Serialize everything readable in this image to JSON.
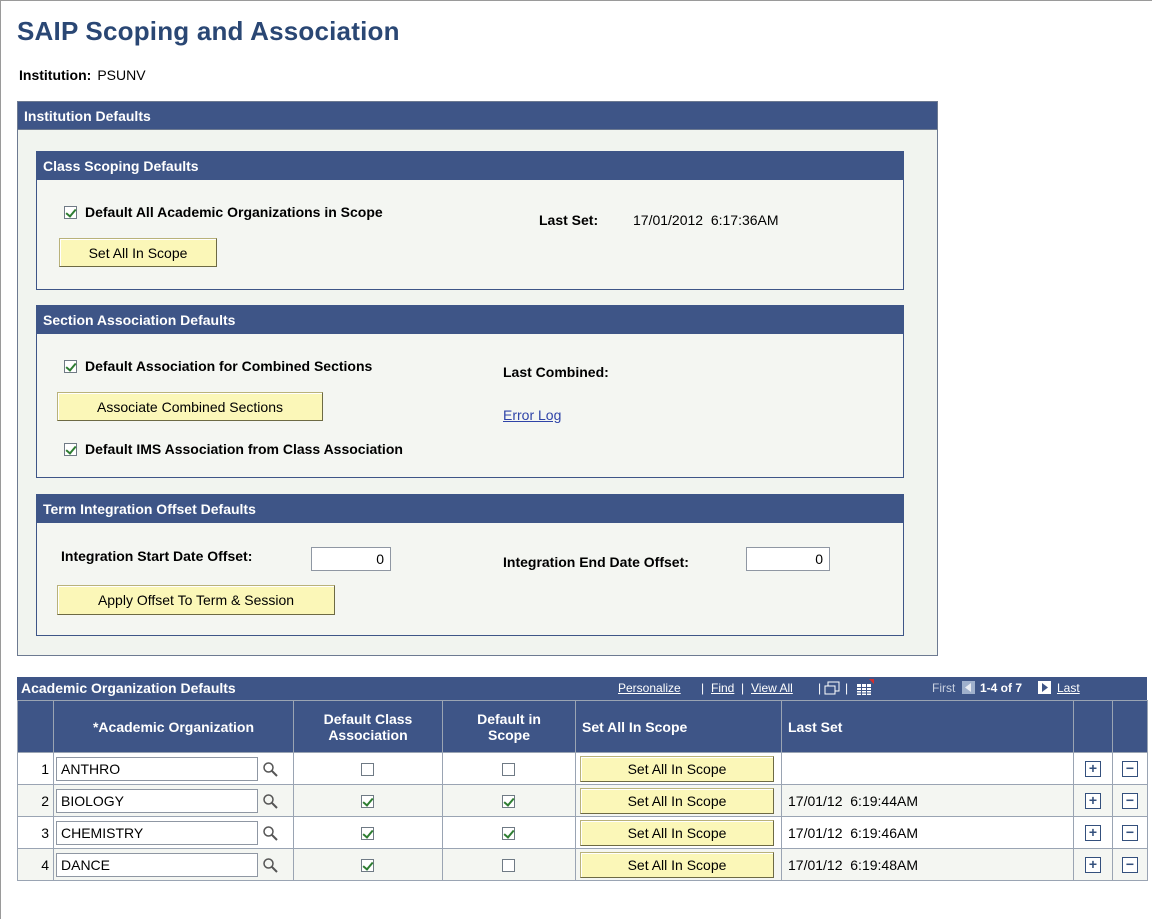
{
  "page": {
    "title": "SAIP Scoping and Association",
    "institution_label": "Institution:",
    "institution_value": "PSUNV"
  },
  "institution_defaults": {
    "header": "Institution Defaults",
    "class_scoping": {
      "header": "Class Scoping Defaults",
      "default_all_label": "Default All Academic Organizations in Scope",
      "default_all_checked": true,
      "last_set_label": "Last Set:",
      "last_set_value": "17/01/2012  6:17:36AM",
      "set_all_button": "Set All In Scope"
    },
    "section_association": {
      "header": "Section Association Defaults",
      "default_combined_label": "Default Association for Combined Sections",
      "default_combined_checked": true,
      "last_combined_label": "Last Combined:",
      "associate_button": "Associate Combined Sections",
      "error_log_link": "Error Log",
      "default_ims_label": "Default IMS Association from Class Association",
      "default_ims_checked": true
    },
    "term_integration": {
      "header": "Term Integration Offset Defaults",
      "start_offset_label": "Integration Start Date Offset:",
      "start_offset_value": "0",
      "end_offset_label": "Integration End Date Offset:",
      "end_offset_value": "0",
      "apply_button": "Apply Offset To Term & Session"
    }
  },
  "academic_org_grid": {
    "title": "Academic Organization Defaults",
    "personalize": "Personalize",
    "find": "Find",
    "view_all": "View All",
    "first": "First",
    "range": "1-4 of 7",
    "last": "Last",
    "columns": {
      "org": "*Academic Organization",
      "class_assoc": "Default Class Association",
      "in_scope": "Default in Scope",
      "set_all": "Set All In Scope",
      "last_set": "Last Set"
    },
    "rows": [
      {
        "num": "1",
        "org": "ANTHRO",
        "class_assoc": false,
        "in_scope": false,
        "button": "Set All In Scope",
        "last_set": ""
      },
      {
        "num": "2",
        "org": "BIOLOGY",
        "class_assoc": true,
        "in_scope": true,
        "button": "Set All In Scope",
        "last_set": "17/01/12  6:19:44AM"
      },
      {
        "num": "3",
        "org": "CHEMISTRY",
        "class_assoc": true,
        "in_scope": true,
        "button": "Set All In Scope",
        "last_set": "17/01/12  6:19:46AM"
      },
      {
        "num": "4",
        "org": "DANCE",
        "class_assoc": true,
        "in_scope": false,
        "button": "Set All In Scope",
        "last_set": "17/01/12  6:19:48AM"
      }
    ]
  },
  "colors": {
    "header_blue": "#3e5587",
    "title_blue": "#2a4774",
    "button_yellow": "#fbf7b8",
    "check_green": "#2e7d32"
  }
}
